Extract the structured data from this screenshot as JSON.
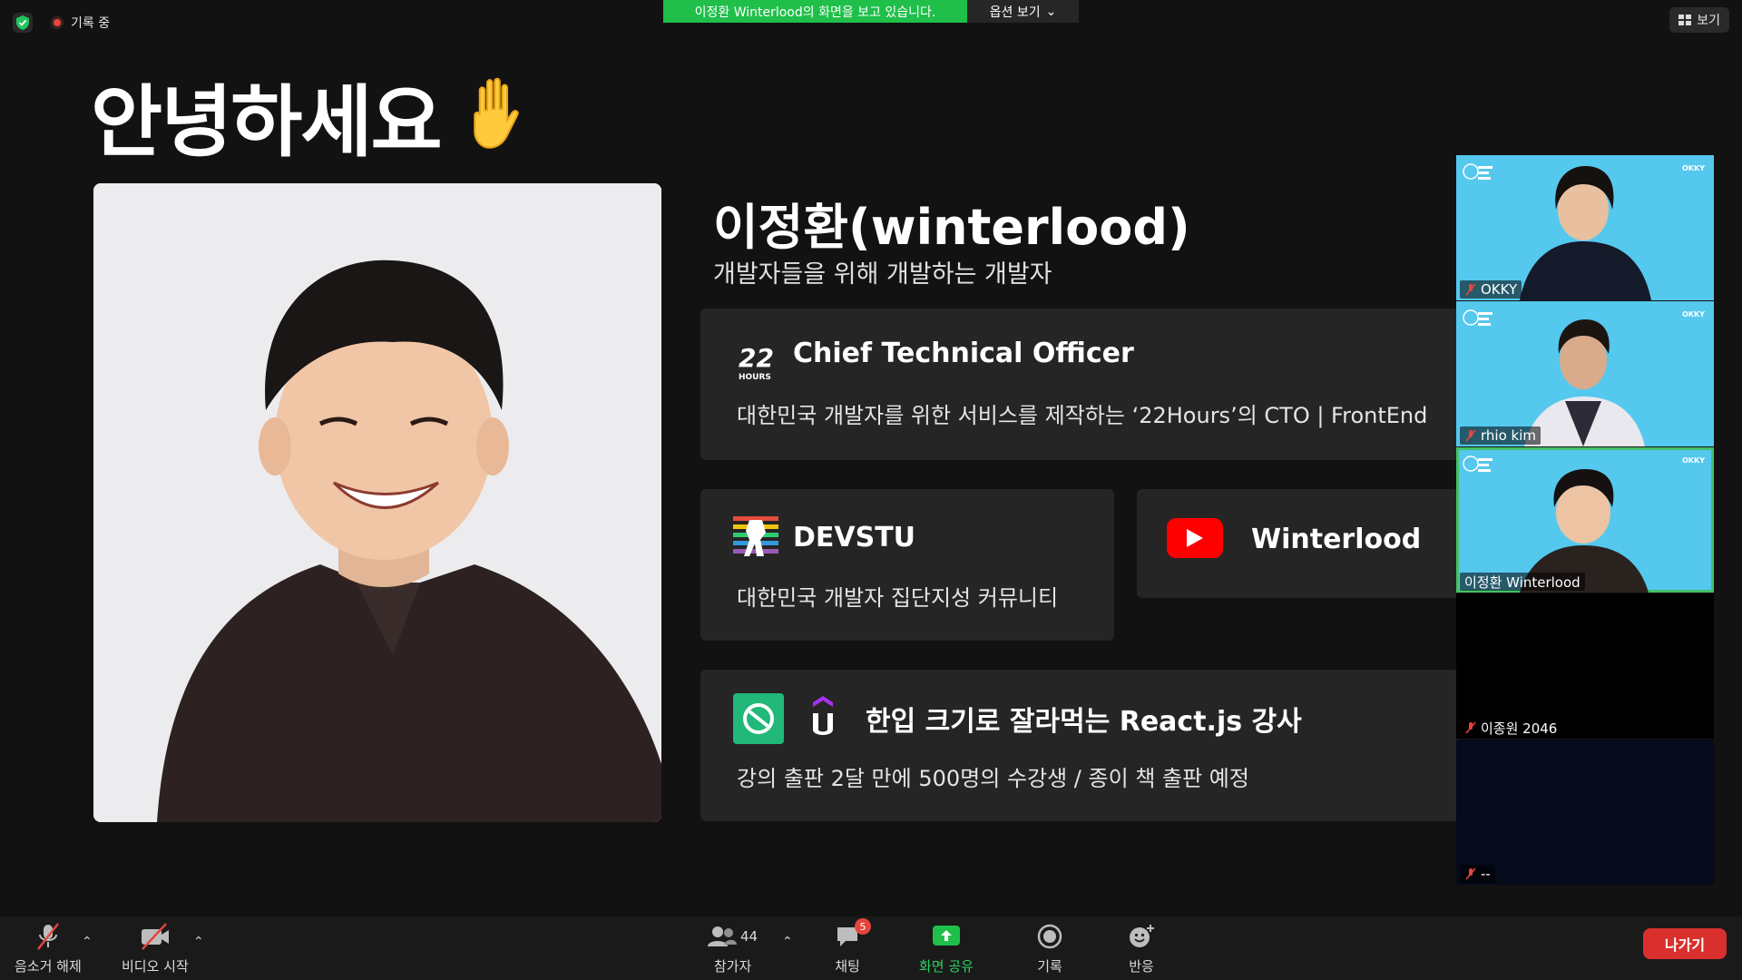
{
  "topbar": {
    "recording_label": "기록 중",
    "viewing_banner": "이정환 Winterlood의 화면을 보고 있습니다.",
    "view_options_label": "옵션 보기",
    "view_button_label": "보기"
  },
  "slide": {
    "title": "안녕하세요",
    "name": "이정환(winterlood)",
    "tagline": "개발자들을 위해 개발하는 개발자",
    "cards": {
      "cto": {
        "title": "Chief Technical Officer",
        "description": "대한민국 개발자를 위한 서비스를 제작하는 ‘22Hours’의 CTO | FrontEnd",
        "logo_text": "HOURS"
      },
      "devstu": {
        "title": "DEVSTU",
        "description": "대한민국 개발자 집단지성 커뮤니티"
      },
      "youtube": {
        "title": "Winterlood"
      },
      "react": {
        "title": "한입 크기로 잘라먹는 React.js 강사",
        "description": "강의 출판 2달 만에 500명의 수강생 / 종이 책 출판 예정"
      }
    }
  },
  "participants": [
    {
      "name": "OKKY",
      "muted": true,
      "video": true
    },
    {
      "name": "rhio kim",
      "muted": true,
      "video": true
    },
    {
      "name": "이정환 Winterlood",
      "muted": false,
      "video": true,
      "active": true
    },
    {
      "name": "이종원 2046",
      "muted": true,
      "video": false
    },
    {
      "name": "--",
      "muted": true,
      "video": false
    }
  ],
  "tile_brand": "OKKY",
  "toolbar": {
    "unmute_label": "음소거 해제",
    "start_video_label": "비디오 시작",
    "participants_label": "참가자",
    "participants_count": "44",
    "chat_label": "채팅",
    "chat_badge": "5",
    "share_label": "화면 공유",
    "record_label": "기록",
    "reactions_label": "반응",
    "leave_label": "나가기"
  },
  "colors": {
    "share_green": "#1fbf4a",
    "leave_red": "#d9302d",
    "card_bg": "#252525",
    "tile_blue": "#55c8ee"
  }
}
